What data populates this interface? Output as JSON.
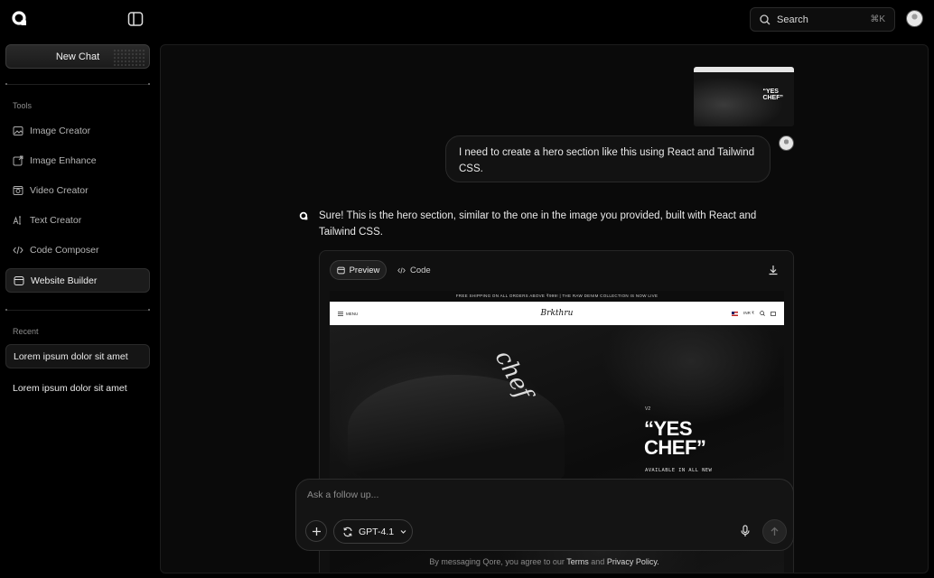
{
  "search": {
    "label": "Search",
    "shortcut": "⌘K"
  },
  "sidebar": {
    "new_chat_label": "New Chat",
    "tools_heading": "Tools",
    "tools": [
      {
        "label": "Image Creator",
        "icon": "image-icon"
      },
      {
        "label": "Image Enhance",
        "icon": "image-enhance-icon"
      },
      {
        "label": "Video Creator",
        "icon": "video-icon"
      },
      {
        "label": "Text Creator",
        "icon": "text-icon"
      },
      {
        "label": "Code Composer",
        "icon": "code-icon"
      },
      {
        "label": "Website Builder",
        "icon": "website-icon",
        "active": true
      }
    ],
    "recent_heading": "Recent",
    "recent": [
      {
        "label": "Lorem ipsum dolor sit amet",
        "active": true
      },
      {
        "label": "Lorem ipsum dolor sit amet"
      }
    ]
  },
  "chat": {
    "user_message": "I need to create a hero section like this using React and Tailwind CSS.",
    "assistant_message": "Sure! This is the hero section, similar to the one in the image you provided, built with React and Tailwind CSS.",
    "preview_tab": "Preview",
    "code_tab": "Code"
  },
  "site_preview": {
    "announcement": "FREE SHIPPING ON ALL ORDERS ABOVE ₹999! | THE RAW DENIM COLLECTION IS NOW LIVE",
    "menu": "MENU",
    "brand": "Brkthru",
    "currency": "INR ₹",
    "hero_tag": "V2",
    "hero_headline": "“YES CHEF”",
    "hero_sub": "AVAILABLE IN ALL NEW",
    "cap_script": "chef"
  },
  "composer": {
    "placeholder": "Ask a follow up...",
    "model": "GPT-4.1"
  },
  "footer": {
    "prefix": "By messaging Qore, you agree to our",
    "terms": "Terms",
    "and": "and",
    "privacy": "Privacy Policy."
  },
  "colors": {
    "background": "#000000",
    "panel": "#0a0a0a",
    "border": "#2a2a2a",
    "text": "#e9e9e9"
  }
}
